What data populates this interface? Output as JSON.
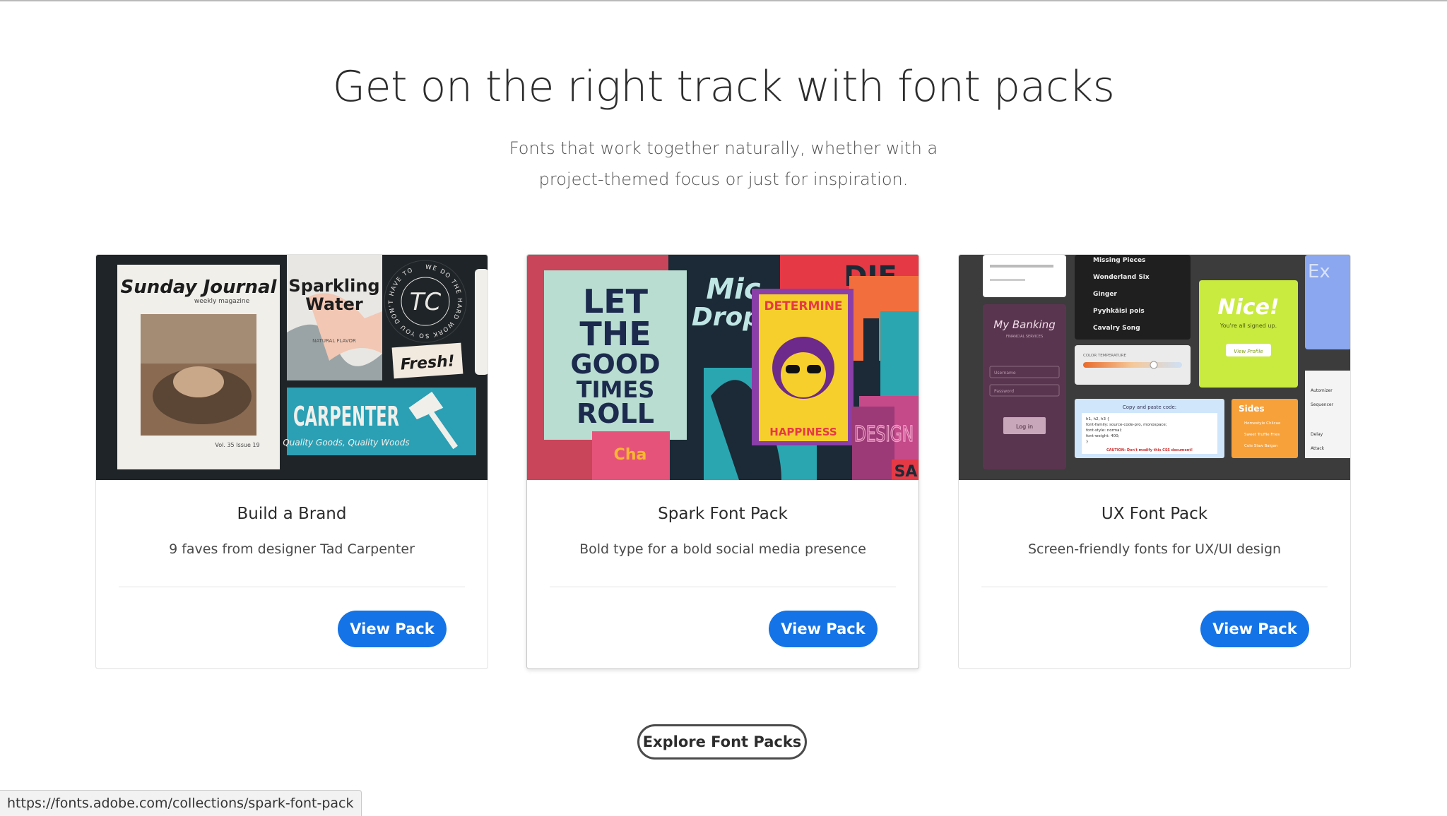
{
  "header": {
    "title": "Get on the right track with font packs",
    "subtitle": "Fonts that work together naturally, whether with a project-themed focus or just for inspiration."
  },
  "cards": [
    {
      "title": "Build a Brand",
      "description": "9 faves from designer Tad Carpenter",
      "button_label": "View Pack",
      "art_text": {
        "journal": "Sunday Journal",
        "journal_sub": "weekly magazine",
        "journal_issue": "Vol. 35   Issue 19",
        "sparkling": "Sparkling",
        "water": "Water",
        "natural": "NATURAL FLAVOR",
        "badge": "TC",
        "badge_ring": "WE DO THE HARD WORK SO YOU DON'T HAVE TO",
        "fresh": "Fresh!",
        "carpenter": "CARPENTER",
        "carpenter_sub": "Quality Goods, Quality Woods"
      }
    },
    {
      "title": "Spark Font Pack",
      "description": "Bold type for a bold social media presence",
      "button_label": "View Pack",
      "art_text": {
        "let": "LET",
        "the": "THE",
        "good": "GOOD",
        "times": "TIMES",
        "roll": "ROLL",
        "mic": "Mic",
        "drop": "Drop",
        "determine": "DETERMINE",
        "happiness": "HAPPINESS",
        "cha": "Cha",
        "design": "DESIGN",
        "sa": "SA"
      }
    },
    {
      "title": "UX Font Pack",
      "description": "Screen-friendly fonts for UX/UI design",
      "button_label": "View Pack",
      "art_text": {
        "banking": "My Banking",
        "banking_sub": "FINANCIAL SERVICES",
        "username": "Username",
        "password": "Password",
        "login": "Log in",
        "songs": [
          "Missing Pieces",
          "Wonderland Six",
          "Ginger",
          "Pyyhkäisi pois",
          "Cavalry Song"
        ],
        "nice": "Nice!",
        "signed_up": "You're all signed up.",
        "view_profile": "View Profile",
        "color_temp": "COLOR TEMPERATURE",
        "copy_paste": "Copy and paste code:",
        "code": [
          "h1, h2, h3 {",
          "  font-family: source-code-pro, monospace;",
          "  font-style: normal;",
          "  font-weight: 400;",
          "}"
        ],
        "caution": "CAUTION: Don't modify this CSS document!",
        "sides": "Sides",
        "sides_items": [
          "Homestyle Chilcae",
          "Sweet Truffle Fries",
          "Cole Slaw Baigan"
        ],
        "menu_items": [
          "Automizer",
          "Sequencer",
          "Delay",
          "Attack"
        ],
        "ex": "Ex"
      }
    }
  ],
  "explore_button": "Explore Font Packs",
  "status_url": "https://fonts.adobe.com/collections/spark-font-pack",
  "colors": {
    "accent": "#1473e6",
    "text": "#2c2c2c"
  }
}
